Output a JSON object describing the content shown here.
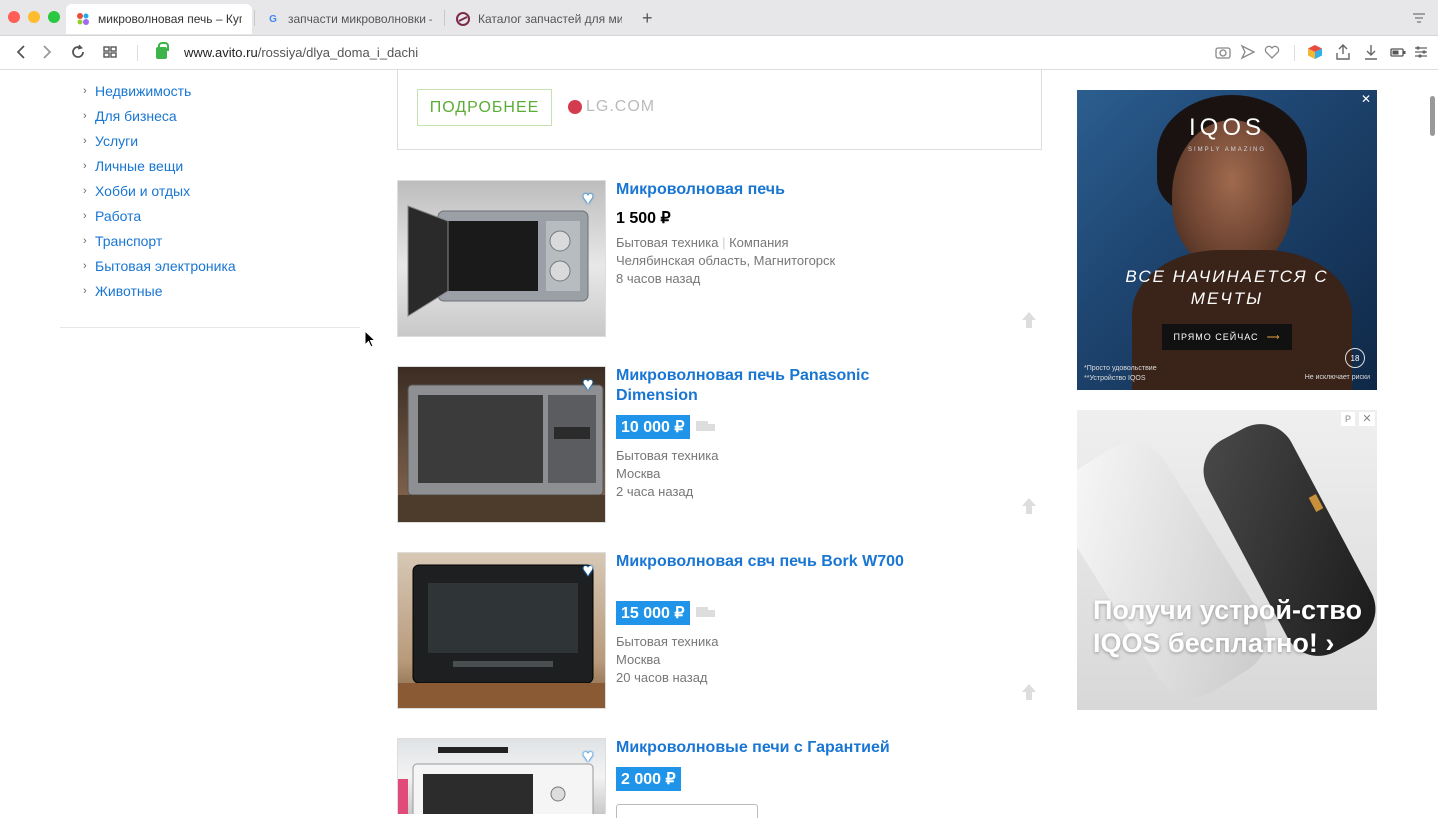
{
  "browser": {
    "tabs": [
      {
        "title": "микроволновая печь – Купи",
        "icon": "avito-favicon"
      },
      {
        "title": "запчасти микроволновки –",
        "icon": "google-favicon"
      },
      {
        "title": "Каталог запчастей для мик",
        "icon": "catalog-favicon"
      }
    ],
    "url_domain": "www.avito.ru",
    "url_path": "/rossiya/dlya_doma_i_dachi"
  },
  "sidebar": {
    "categories": [
      "Недвижимость",
      "Для бизнеса",
      "Услуги",
      "Личные вещи",
      "Хобби и отдых",
      "Работа",
      "Транспорт",
      "Бытовая электроника",
      "Животные"
    ]
  },
  "top_ad": {
    "button": "ПОДРОБНЕЕ",
    "domain": "LG.COM"
  },
  "listings": [
    {
      "title": "Микроволновая печь",
      "price": "1 500 ₽",
      "vip": false,
      "category": "Бытовая техника",
      "seller": "Компания",
      "location": "Челябинская область, Магнитогорск",
      "time": "8 часов назад"
    },
    {
      "title": "Микроволновая печь Panasonic Dimension",
      "price": "10 000 ₽",
      "vip": true,
      "category": "Бытовая техника",
      "location": "Москва",
      "time": "2 часа назад"
    },
    {
      "title": "Микроволновая свч печь Bork W700",
      "price": "15 000 ₽",
      "vip": true,
      "category": "Бытовая техника",
      "location": "Москва",
      "time": "20 часов назад"
    },
    {
      "title": "Микроволновые печи с Гарантией",
      "price": "2 000 ₽",
      "vip": true
    }
  ],
  "ads": {
    "iqos_banner": {
      "brand": "IQOS",
      "tagline": "SIMPLY AMAZING",
      "headline": "ВСЕ НАЧИНАЕТСЯ С МЕЧТЫ",
      "cta": "ПРЯМО СЕЙЧАС",
      "footnote1": "*Просто удовольствие",
      "footnote2": "**Устройство IQOS",
      "footnote3": "Не исключает риски",
      "age": "18"
    },
    "iqos_device": {
      "headline": "Получи устрой-ство IQOS бесплатно! ›",
      "marker": "Р"
    }
  },
  "colors": {
    "link": "#1976d2",
    "vip_price_bg": "#1f94e8",
    "ad_button_green": "#5cad35"
  }
}
